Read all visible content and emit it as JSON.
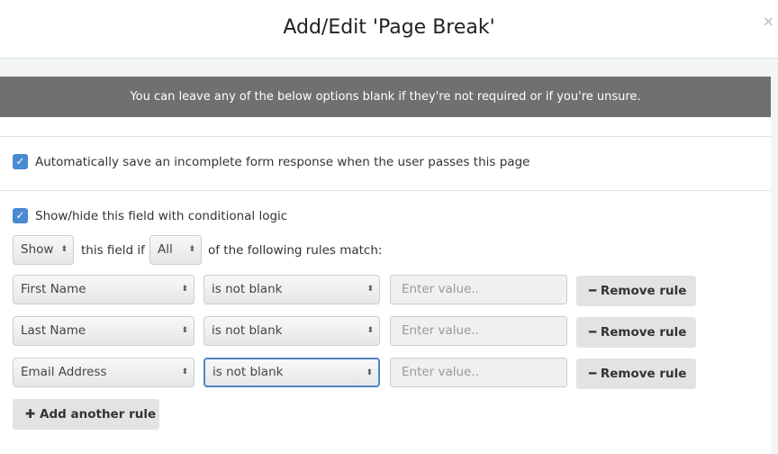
{
  "dialog": {
    "title": "Add/Edit 'Page Break'",
    "close": "×"
  },
  "banner": "You can leave any of the below options blank if they're not required or if you're unsure.",
  "autosave": {
    "checked": true,
    "label": "Automatically save an incomplete form response when the user passes this page"
  },
  "conditional": {
    "checked": true,
    "label": "Show/hide this field with conditional logic",
    "action": "Show",
    "text1": "this field if",
    "match": "All",
    "text2": "of the following rules match:"
  },
  "rules": [
    {
      "field": "First Name",
      "operator": "is not blank",
      "value_placeholder": "Enter value..",
      "remove": "Remove rule"
    },
    {
      "field": "Last Name",
      "operator": "is not blank",
      "value_placeholder": "Enter value..",
      "remove": "Remove rule"
    },
    {
      "field": "Email Address",
      "operator": "is not blank",
      "value_placeholder": "Enter value..",
      "remove": "Remove rule"
    }
  ],
  "add_rule": "Add another rule"
}
